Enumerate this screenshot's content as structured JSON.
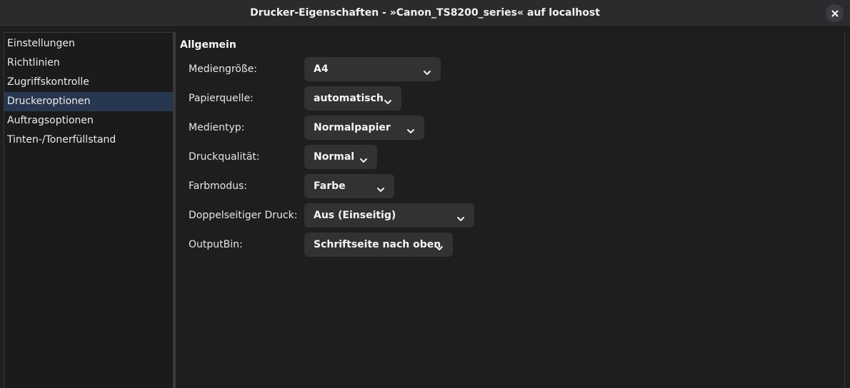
{
  "window": {
    "title": "Drucker-Eigenschaften - »Canon_TS8200_series« auf localhost"
  },
  "sidebar": {
    "items": [
      {
        "label": "Einstellungen"
      },
      {
        "label": "Richtlinien"
      },
      {
        "label": "Zugriffskontrolle"
      },
      {
        "label": "Druckeroptionen",
        "selected": true
      },
      {
        "label": "Auftragsoptionen"
      },
      {
        "label": "Tinten-/Tonerfüllstand"
      }
    ]
  },
  "main": {
    "section_title": "Allgemein",
    "fields": [
      {
        "label": "Mediengröße:",
        "value": "A4"
      },
      {
        "label": "Papierquelle:",
        "value": "automatisch"
      },
      {
        "label": "Medientyp:",
        "value": "Normalpapier"
      },
      {
        "label": "Druckqualität:",
        "value": "Normal"
      },
      {
        "label": "Farbmodus:",
        "value": "Farbe"
      },
      {
        "label": "Doppelseitiger Druck:",
        "value": "Aus (Einseitig)"
      },
      {
        "label": "OutputBin:",
        "value": "Schriftseite nach oben"
      }
    ]
  },
  "colors": {
    "background": "#1e1e20",
    "titlebar": "#2b2b2e",
    "selection": "#283750",
    "dropdown": "#323235"
  }
}
